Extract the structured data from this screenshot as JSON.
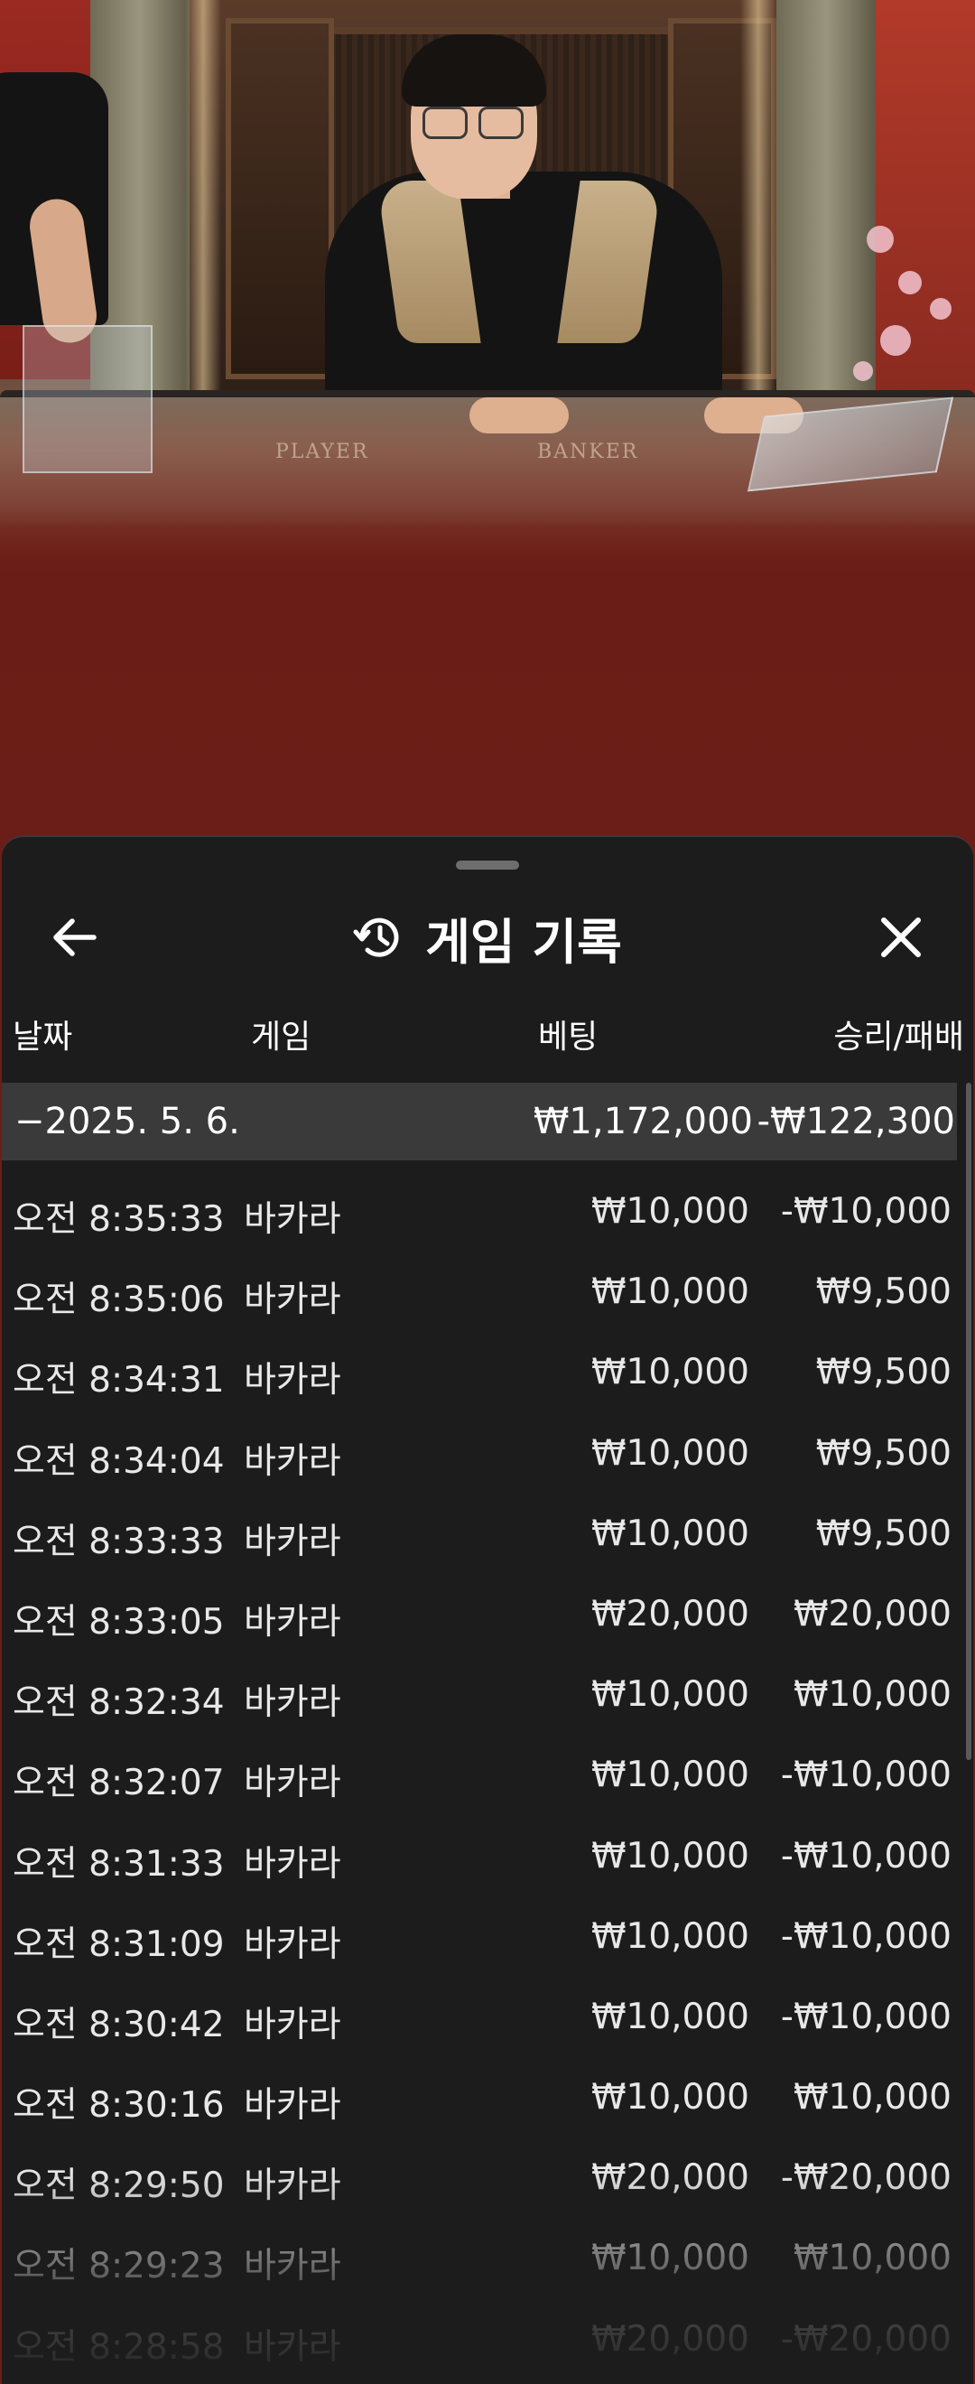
{
  "sheet": {
    "title": "게임 기록",
    "icons": {
      "back": "arrow-left-icon",
      "history": "history-clock-icon",
      "close": "close-icon"
    }
  },
  "scene": {
    "table_player_label": "PLAYER",
    "table_banker_label": "BANKER"
  },
  "columns": {
    "date": "날짜",
    "game": "게임",
    "bet": "베팅",
    "win_loss": "승리/패배"
  },
  "date_group": {
    "date": "−2025. 5. 6.",
    "total_bet": "₩1,172,000",
    "total_win_loss": "-₩122,300"
  },
  "rows": [
    {
      "time": "오전 8:35:33",
      "game": "바카라",
      "bet": "₩10,000",
      "win_loss": "-₩10,000"
    },
    {
      "time": "오전 8:35:06",
      "game": "바카라",
      "bet": "₩10,000",
      "win_loss": "₩9,500"
    },
    {
      "time": "오전 8:34:31",
      "game": "바카라",
      "bet": "₩10,000",
      "win_loss": "₩9,500"
    },
    {
      "time": "오전 8:34:04",
      "game": "바카라",
      "bet": "₩10,000",
      "win_loss": "₩9,500"
    },
    {
      "time": "오전 8:33:33",
      "game": "바카라",
      "bet": "₩10,000",
      "win_loss": "₩9,500"
    },
    {
      "time": "오전 8:33:05",
      "game": "바카라",
      "bet": "₩20,000",
      "win_loss": "₩20,000"
    },
    {
      "time": "오전 8:32:34",
      "game": "바카라",
      "bet": "₩10,000",
      "win_loss": "₩10,000"
    },
    {
      "time": "오전 8:32:07",
      "game": "바카라",
      "bet": "₩10,000",
      "win_loss": "-₩10,000"
    },
    {
      "time": "오전 8:31:33",
      "game": "바카라",
      "bet": "₩10,000",
      "win_loss": "-₩10,000"
    },
    {
      "time": "오전 8:31:09",
      "game": "바카라",
      "bet": "₩10,000",
      "win_loss": "-₩10,000"
    },
    {
      "time": "오전 8:30:42",
      "game": "바카라",
      "bet": "₩10,000",
      "win_loss": "-₩10,000"
    },
    {
      "time": "오전 8:30:16",
      "game": "바카라",
      "bet": "₩10,000",
      "win_loss": "₩10,000"
    },
    {
      "time": "오전 8:29:50",
      "game": "바카라",
      "bet": "₩20,000",
      "win_loss": "-₩20,000"
    },
    {
      "time": "오전 8:29:23",
      "game": "바카라",
      "bet": "₩10,000",
      "win_loss": "₩10,000"
    },
    {
      "time": "오전 8:28:58",
      "game": "바카라",
      "bet": "₩20,000",
      "win_loss": "-₩20,000"
    }
  ]
}
